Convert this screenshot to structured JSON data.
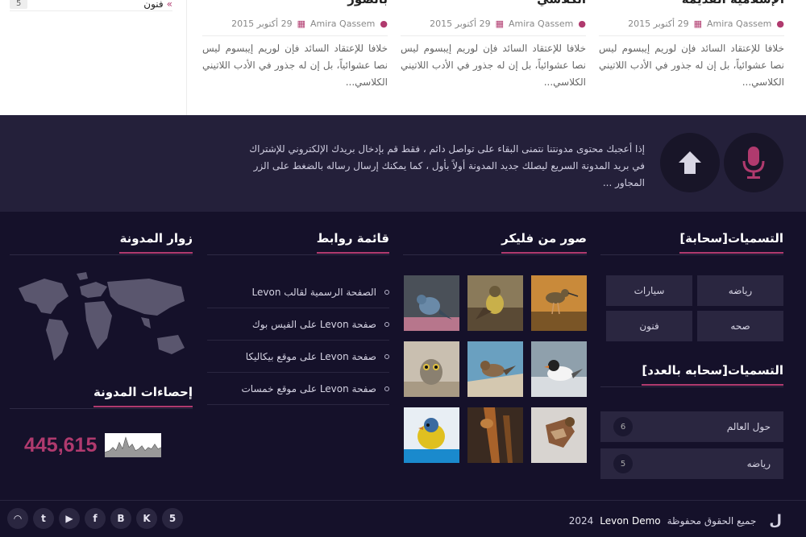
{
  "sidebar_top": {
    "category": "فنون",
    "count": "5"
  },
  "posts": [
    {
      "title_fragment": "الإسلامية القديمة",
      "author": "Amira Qassem",
      "date": "29 أكتوبر 2015",
      "excerpt": "خلافا للإعتقاد السائد فإن لوريم إيبسوم ليس نصا عشوائياً، بل إن له جذور في الأدب اللاتيني الكلاسي..."
    },
    {
      "title_fragment": "الكلاسي",
      "author": "Amira Qassem",
      "date": "29 أكتوبر 2015",
      "excerpt": "خلافا للإعتقاد السائد فإن لوريم إيبسوم ليس نصا عشوائياً، بل إن له جذور في الأدب اللاتيني الكلاسي..."
    },
    {
      "title_fragment": "بالصور",
      "author": "Amira Qassem",
      "date": "29 أكتوبر 2015",
      "excerpt": "خلافا للإعتقاد السائد فإن لوريم إيبسوم ليس نصا عشوائياً، بل إن له جذور في الأدب اللاتيني الكلاسي..."
    }
  ],
  "subscribe": {
    "text": "إذا أعجبك محتوى مدونتنا نتمنى البقاء على تواصل دائم ، فقط قم بإدخال بريدك الإلكتروني للإشتراك في بريد المدونة السريع ليصلك جديد المدونة أولاً بأول ، كما يمكنك إرسال رساله بالضغط على الزر المجاور ..."
  },
  "widgets": {
    "labels_cloud": {
      "title": "التسميات[سحابة]",
      "tags": [
        "رياضه",
        "سيارات",
        "صحه",
        "فنون"
      ]
    },
    "labels_count": {
      "title": "التسميات[سحابه بالعدد]",
      "items": [
        {
          "label": "حول العالم",
          "count": "6"
        },
        {
          "label": "رياضه",
          "count": "5"
        }
      ]
    },
    "flickr": {
      "title": "صور من فليكر"
    },
    "links": {
      "title": "قائمة روابط",
      "items": [
        "الصفحة الرسمية لقالب Levon",
        "صفحة Levon على الفيس بوك",
        "صفحة Levon على موقع بيكاليكا",
        "صفحة Levon على موقع خمسات"
      ]
    },
    "visitors": {
      "title": "زوار المدونة"
    },
    "stats": {
      "title": "إحصاءات المدونة",
      "count": "445,615"
    }
  },
  "footer": {
    "rights": "جميع الحقوق محفوظة",
    "brand": "Levon Demo",
    "year": "2024",
    "social_icons": [
      "rss-icon",
      "twitter-icon",
      "youtube-icon",
      "facebook-icon",
      "blogger-icon",
      "vk-icon",
      "html5-icon"
    ]
  },
  "colors": {
    "accent": "#b03a6e",
    "band": "#24203a",
    "footer": "#15112a",
    "tile": "#2a2640"
  }
}
